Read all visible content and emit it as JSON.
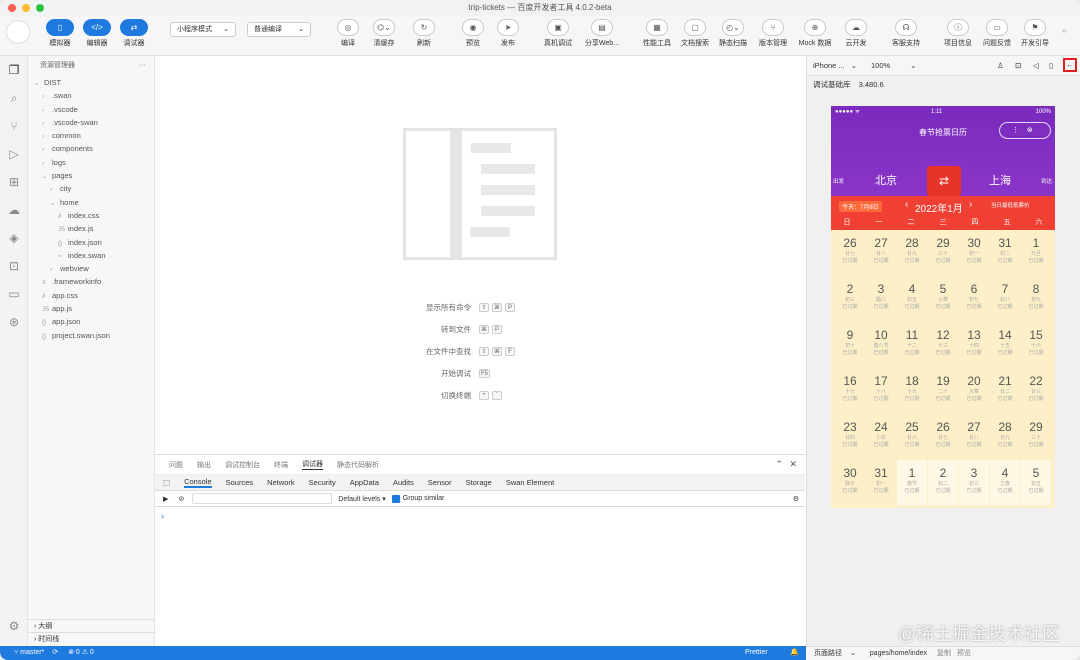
{
  "title": "trip-tickets — 百度开发者工具 4.0.2-beta",
  "toolbar": {
    "left": [
      "模拟器",
      "编辑器",
      "调试器"
    ],
    "mode": "小程序模式",
    "compile": "普通编译",
    "mid": [
      "编译",
      "清缓存",
      "刷新",
      "预览",
      "发布",
      "真机调试",
      "分享Web..."
    ],
    "right": [
      "性能工具",
      "文档搜索",
      "静态扫描",
      "版本管理",
      "Mock 数据",
      "云开发",
      "客服支持",
      "项目信息",
      "问题反馈",
      "开发引导"
    ]
  },
  "explorer": {
    "header": "资源管理器",
    "items": [
      {
        "t": "DIST",
        "l": 0,
        "a": "⌄"
      },
      {
        "t": ".swan",
        "l": 1,
        "a": "›"
      },
      {
        "t": ".vscode",
        "l": 1,
        "a": "›"
      },
      {
        "t": ".vscode-swan",
        "l": 1,
        "a": "›"
      },
      {
        "t": "common",
        "l": 1,
        "a": "›"
      },
      {
        "t": "components",
        "l": 1,
        "a": "›"
      },
      {
        "t": "logs",
        "l": 1,
        "a": "›"
      },
      {
        "t": "pages",
        "l": 1,
        "a": "⌄"
      },
      {
        "t": "city",
        "l": 2,
        "a": "›"
      },
      {
        "t": "home",
        "l": 2,
        "a": "⌄"
      },
      {
        "t": "index.css",
        "l": 3,
        "a": "#"
      },
      {
        "t": "index.js",
        "l": 3,
        "a": "JS"
      },
      {
        "t": "index.json",
        "l": 3,
        "a": "{}"
      },
      {
        "t": "index.swan",
        "l": 3,
        "a": "≈"
      },
      {
        "t": "webview",
        "l": 2,
        "a": "›"
      },
      {
        "t": ".frameworkinfo",
        "l": 1,
        "a": "≡"
      },
      {
        "t": "app.css",
        "l": 1,
        "a": "#"
      },
      {
        "t": "app.js",
        "l": 1,
        "a": "JS"
      },
      {
        "t": "app.json",
        "l": 1,
        "a": "{}"
      },
      {
        "t": "project.swan.json",
        "l": 1,
        "a": "{}"
      }
    ],
    "outline": "大纲",
    "timeline": "时间线"
  },
  "commands": [
    {
      "label": "显示所有命令",
      "keys": [
        "⇧",
        "⌘",
        "P"
      ]
    },
    {
      "label": "转到文件",
      "keys": [
        "⌘",
        "P"
      ]
    },
    {
      "label": "在文件中查找",
      "keys": [
        "⇧",
        "⌘",
        "F"
      ]
    },
    {
      "label": "开始调试",
      "keys": [
        "F5"
      ]
    },
    {
      "label": "切换终端",
      "keys": [
        "^",
        "`"
      ]
    }
  ],
  "panel": {
    "tabs": [
      "问题",
      "输出",
      "调试控制台",
      "终端",
      "调试器",
      "静态代码解析"
    ],
    "devtabs": [
      "Console",
      "Sources",
      "Network",
      "Security",
      "AppData",
      "Audits",
      "Sensor",
      "Storage",
      "Swan Element"
    ],
    "levels": "Default levels ▾",
    "group": "Group similar",
    "prompt": "›"
  },
  "sim": {
    "device": "iPhone ...",
    "zoom": "100%",
    "baselib_label": "调试基础库",
    "baselib": "3.480.6",
    "time": "1:11",
    "battery": "100%",
    "carrier": "●●●●● ᯤ",
    "title": "春节抢票日历",
    "from": "北京",
    "to": "上海",
    "from_tag": "出发",
    "to_tag": "到达",
    "today": "今天：7月8日",
    "month": "2022年1月",
    "lowest": "当日最低抵票价",
    "weekdays": [
      "日",
      "一",
      "二",
      "三",
      "四",
      "五",
      "六"
    ],
    "days": [
      {
        "d": "26",
        "s": "廿七",
        "s2": "已过期"
      },
      {
        "d": "27",
        "s": "廿八",
        "s2": "已过期"
      },
      {
        "d": "28",
        "s": "廿九",
        "s2": "已过期"
      },
      {
        "d": "29",
        "s": "三十",
        "s2": "已过期"
      },
      {
        "d": "30",
        "s": "初一",
        "s2": "已过期"
      },
      {
        "d": "31",
        "s": "初二",
        "s2": "已过期"
      },
      {
        "d": "1",
        "s": "元旦",
        "s2": "已过期"
      },
      {
        "d": "2",
        "s": "初三",
        "s2": "已过期"
      },
      {
        "d": "3",
        "s": "腊八",
        "s2": "已过期"
      },
      {
        "d": "4",
        "s": "初五",
        "s2": "已过期"
      },
      {
        "d": "5",
        "s": "小寒",
        "s2": "已过期"
      },
      {
        "d": "6",
        "s": "初七",
        "s2": "已过期"
      },
      {
        "d": "7",
        "s": "初八",
        "s2": "已过期"
      },
      {
        "d": "8",
        "s": "初九",
        "s2": "已过期"
      },
      {
        "d": "9",
        "s": "初十",
        "s2": "已过期"
      },
      {
        "d": "10",
        "s": "腊八节",
        "s2": "已过期"
      },
      {
        "d": "11",
        "s": "十二",
        "s2": "已过期"
      },
      {
        "d": "12",
        "s": "十三",
        "s2": "已过期"
      },
      {
        "d": "13",
        "s": "十四",
        "s2": "已过期"
      },
      {
        "d": "14",
        "s": "十五",
        "s2": "已过期"
      },
      {
        "d": "15",
        "s": "十六",
        "s2": "已过期"
      },
      {
        "d": "16",
        "s": "十七",
        "s2": "已过期"
      },
      {
        "d": "17",
        "s": "十八",
        "s2": "已过期"
      },
      {
        "d": "18",
        "s": "十九",
        "s2": "已过期"
      },
      {
        "d": "19",
        "s": "二十",
        "s2": "已过期"
      },
      {
        "d": "20",
        "s": "大寒",
        "s2": "已过期"
      },
      {
        "d": "21",
        "s": "廿二",
        "s2": "已过期"
      },
      {
        "d": "22",
        "s": "廿三",
        "s2": "已过期"
      },
      {
        "d": "23",
        "s": "廿四",
        "s2": "已过期"
      },
      {
        "d": "24",
        "s": "小年",
        "s2": "已过期"
      },
      {
        "d": "25",
        "s": "廿六",
        "s2": "已过期"
      },
      {
        "d": "26",
        "s": "廿七",
        "s2": "已过期"
      },
      {
        "d": "27",
        "s": "廿八",
        "s2": "已过期"
      },
      {
        "d": "28",
        "s": "廿九",
        "s2": "已过期"
      },
      {
        "d": "29",
        "s": "三十",
        "s2": "已过期"
      },
      {
        "d": "30",
        "s": "除夕",
        "s2": "已过期"
      },
      {
        "d": "31",
        "s": "初一",
        "s2": "已过期"
      },
      {
        "d": "1",
        "s": "春节",
        "s2": "已过期"
      },
      {
        "d": "2",
        "s": "初二",
        "s2": "已过期"
      },
      {
        "d": "3",
        "s": "初三",
        "s2": "已过期"
      },
      {
        "d": "4",
        "s": "立春",
        "s2": "已过期"
      },
      {
        "d": "5",
        "s": "初五",
        "s2": "已过期"
      }
    ]
  },
  "status": {
    "branch": "master*",
    "sync": "⟳",
    "problems": "⊗ 0 ⚠ 0",
    "prettier": "Prettier",
    "bell": "🔔"
  },
  "bottom": {
    "label": "页面路径",
    "path": "pages/home/index",
    "copy": "复制",
    "preview": "预览"
  },
  "watermark": "@稀土掘金技术社区"
}
